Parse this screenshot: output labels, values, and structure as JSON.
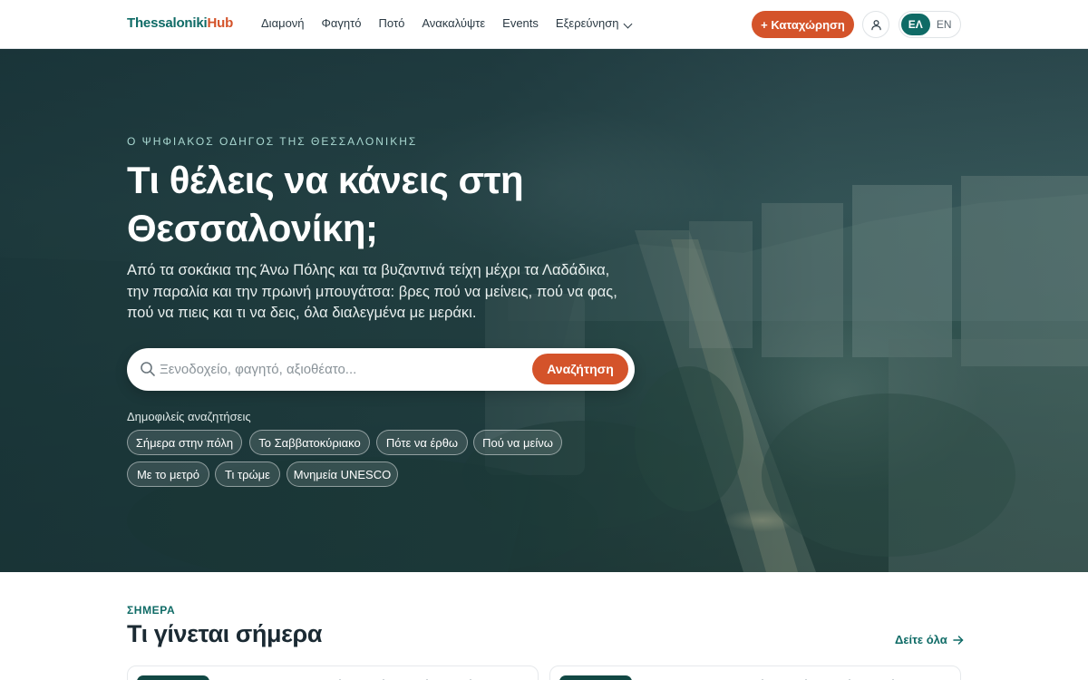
{
  "header": {
    "logo_part1": "Thessaloniki",
    "logo_part2": "Hub",
    "nav": [
      "Διαμονή",
      "Φαγητό",
      "Ποτό",
      "Ανακαλύψτε",
      "Events"
    ],
    "explore_label": "Εξερεύνηση",
    "listing_button": "+ Καταχώρηση",
    "lang_el": "ΕΛ",
    "lang_en": "EN"
  },
  "hero": {
    "eyebrow": "Ο ΨΗΦΙΑΚΟΣ ΟΔΗΓΟΣ ΤΗΣ ΘΕΣΣΑΛΟΝΙΚΗΣ",
    "title": "Τι θέλεις να κάνεις στη Θεσσαλονίκη;",
    "subtitle": "Από τα σοκάκια της Άνω Πόλης και τα βυζαντινά τείχη μέχρι τα Λαδάδικα, την παραλία και την πρωινή μπουγάτσα: βρες πού να μείνεις, πού να φας, πού να πιεις και τι να δεις, όλα διαλεγμένα με μεράκι.",
    "search_placeholder": "Ξενοδοχείο, φαγητό, αξιοθέατο...",
    "search_button": "Αναζήτηση",
    "popular_label": "Δημοφιλείς αναζητήσεις",
    "chips": [
      "Σήμερα στην πόλη",
      "Το Σαββατοκύριακο",
      "Πότε να έρθω",
      "Πού να μείνω",
      "Με το μετρό",
      "Τι τρώμε",
      "Μνημεία UNESCO"
    ]
  },
  "today": {
    "eyebrow": "ΣΗΜΕΡΑ",
    "title": "Τι γίνεται σήμερα",
    "see_all": "Δείτε όλα"
  },
  "colors": {
    "brand_teal": "#0f6b66",
    "brand_orange": "#d4532a"
  }
}
